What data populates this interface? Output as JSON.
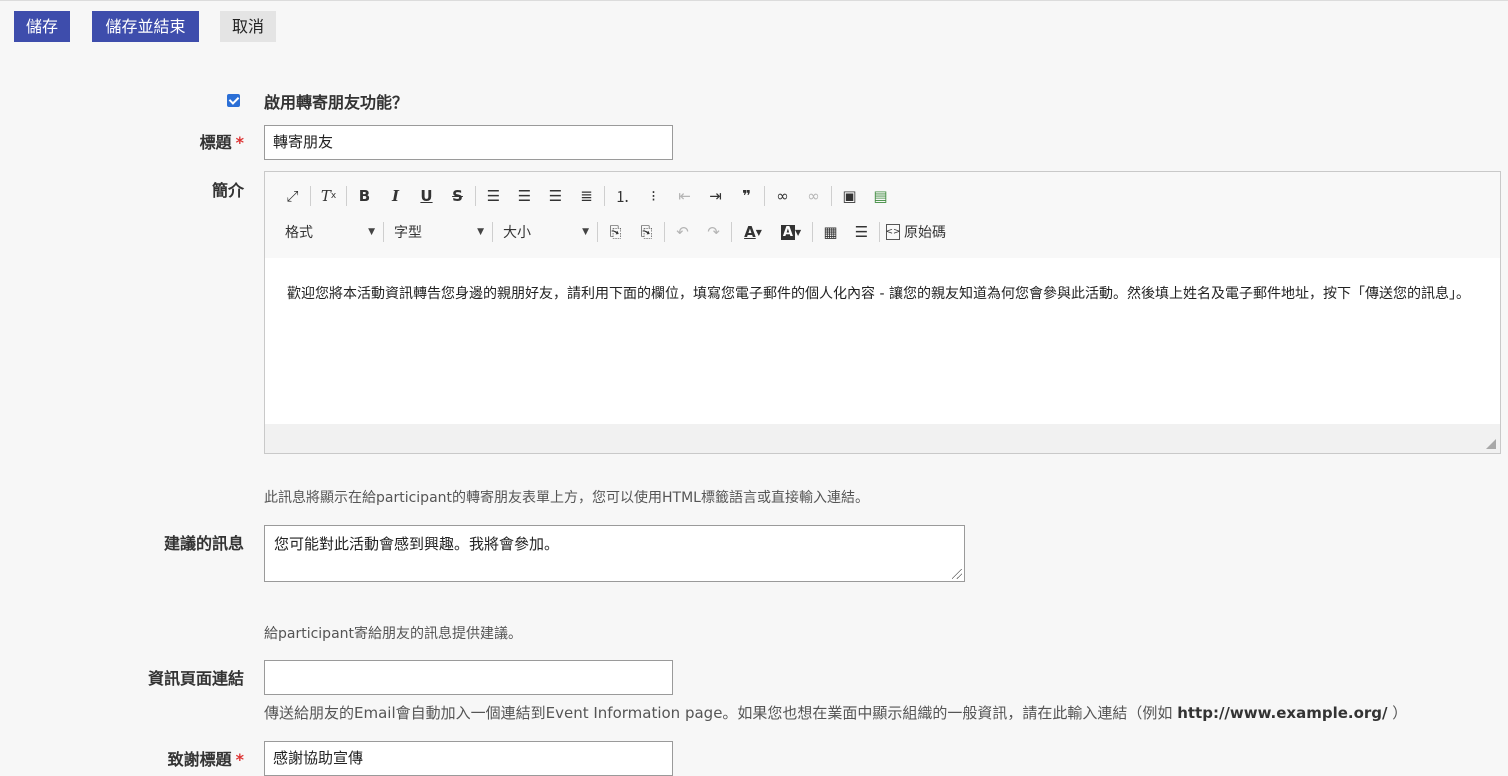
{
  "actions": {
    "save": "儲存",
    "save_and_close": "儲存並結束",
    "cancel": "取消"
  },
  "enable": {
    "checked": true,
    "label": "啟用轉寄朋友功能？"
  },
  "title_field": {
    "label": "標題",
    "required_mark": "*",
    "value": "轉寄朋友"
  },
  "intro": {
    "label": "簡介",
    "toolbar_row1_icons": [
      "maximize-icon",
      "remove-format-icon",
      "bold-icon",
      "italic-icon",
      "underline-icon",
      "strikethrough-icon",
      "align-left-icon",
      "align-center-icon",
      "align-right-icon",
      "align-justify-icon",
      "numbered-list-icon",
      "bulleted-list-icon",
      "outdent-icon",
      "indent-icon",
      "blockquote-icon",
      "link-icon",
      "unlink-icon",
      "image-icon",
      "media-icon"
    ],
    "toolbar_row2": {
      "format": "格式",
      "font": "字型",
      "size": "大小",
      "source": "原始碼"
    },
    "content": "歡迎您將本活動資訊轉告您身邊的親朋好友，請利用下面的欄位，填寫您電子郵件的個人化內容 - 讓您的親友知道為何您會參與此活動。然後填上姓名及電子郵件地址，按下「傳送您的訊息」。",
    "help": "此訊息將顯示在給participant的轉寄朋友表單上方，您可以使用HTML標籤語言或直接輸入連結。"
  },
  "suggested_message": {
    "label": "建議的訊息",
    "value": "您可能對此活動會感到興趣。我將會參加。",
    "help": "給participant寄給朋友的訊息提供建議。"
  },
  "info_link": {
    "label": "資訊頁面連結",
    "value": "",
    "help_prefix": "傳送給朋友的Email會自動加入一個連結到Event Information page。如果您也想在業面中顯示組織的一般資訊，請在此輸入連結（例如 ",
    "help_example": "http://www.example.org/",
    "help_suffix": " ）"
  },
  "thanks_title": {
    "label": "致謝標題",
    "required_mark": "*",
    "value": "感謝協助宣傳"
  }
}
